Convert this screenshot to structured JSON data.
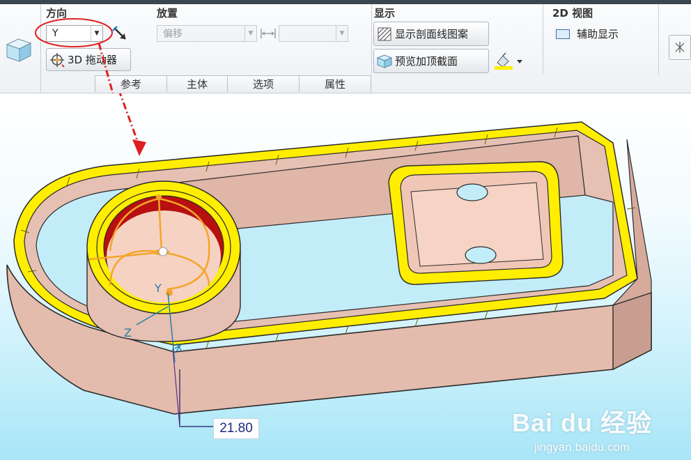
{
  "ribbon": {
    "groups": {
      "direction": {
        "title": "方向",
        "axis_value": "Y",
        "drag_button": "3D 拖动器"
      },
      "placement": {
        "title": "放置",
        "offset_value": "偏移",
        "offset_amount": ""
      },
      "display": {
        "title": "显示",
        "show_hatch": "显示剖面线图案",
        "preview_cap": "预览加顶截面"
      },
      "view2d": {
        "title": "2D 视图",
        "aux_display": "辅助显示"
      }
    },
    "tabs": [
      "参考",
      "主体",
      "选项",
      "属性"
    ]
  },
  "viewport": {
    "dimension_value": "21.80",
    "axis_labels": {
      "y": "Y",
      "z": "Z",
      "x": "X"
    }
  },
  "watermark": {
    "brand": "Bai du 经验",
    "url": "jingyan.baidu.com"
  },
  "colors": {
    "annotation": "#e02020",
    "cap_yellow": "#ffee00",
    "body": "#e9c3b5",
    "dragger": "#f4a52a"
  }
}
